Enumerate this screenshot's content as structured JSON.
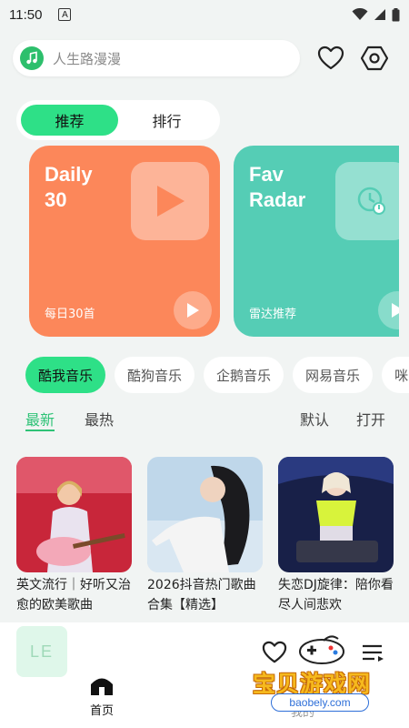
{
  "status_bar": {
    "time": "11:50",
    "notif_letter": "A"
  },
  "search": {
    "placeholder": "人生路漫漫"
  },
  "segment": {
    "tabs": [
      {
        "label": "推荐",
        "active": true
      },
      {
        "label": "排行",
        "active": false
      }
    ]
  },
  "cards": [
    {
      "title": "Daily\n30",
      "subtitle": "每日30首",
      "color": "#fc875a",
      "icon": "play-icon"
    },
    {
      "title": "Fav\nRadar",
      "subtitle": "雷达推荐",
      "color": "#55cdb5",
      "icon": "radar-clock-icon"
    }
  ],
  "sources": [
    {
      "label": "酷我音乐",
      "active": true
    },
    {
      "label": "酷狗音乐",
      "active": false
    },
    {
      "label": "企鹅音乐",
      "active": false
    },
    {
      "label": "网易音乐",
      "active": false
    },
    {
      "label": "咪",
      "active": false
    }
  ],
  "list_tabs": {
    "newest": "最新",
    "hottest": "最热",
    "default": "默认",
    "open": "打开"
  },
  "playlists": [
    {
      "title": "英文流行｜好听又治愈的欧美歌曲"
    },
    {
      "title": "2026抖音热门歌曲合集【精选】"
    },
    {
      "title": "失恋DJ旋律：陪你看尽人间悲欢"
    }
  ],
  "player": {
    "art_text": "LE"
  },
  "bottom_nav": {
    "home": "首页",
    "mine": "我的"
  },
  "watermark": {
    "text": "宝贝游戏网",
    "url": "baobely.com"
  },
  "colors": {
    "accent": "#2ee087",
    "accent_text": "#2ec276",
    "orange_card": "#fc875a",
    "teal_card": "#55cdb5"
  }
}
